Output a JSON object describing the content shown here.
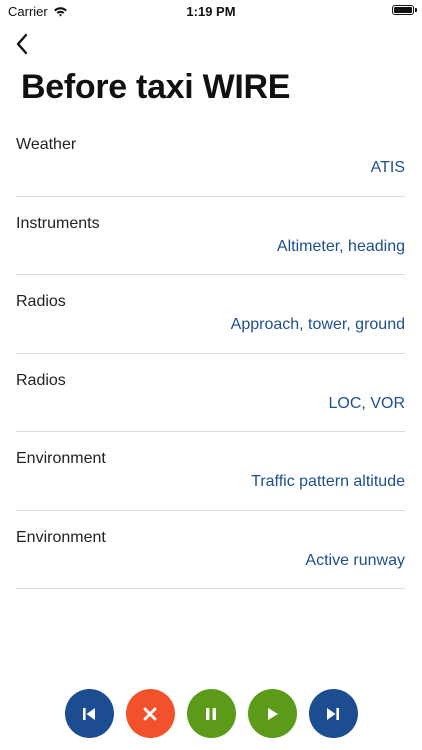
{
  "status_bar": {
    "carrier": "Carrier",
    "time": "1:19 PM"
  },
  "header": {
    "title": "Before taxi WIRE"
  },
  "items": [
    {
      "label": "Weather",
      "value": "ATIS"
    },
    {
      "label": "Instruments",
      "value": "Altimeter, heading"
    },
    {
      "label": "Radios",
      "value": "Approach, tower, ground"
    },
    {
      "label": "Radios",
      "value": "LOC, VOR"
    },
    {
      "label": "Environment",
      "value": "Traffic pattern altitude"
    },
    {
      "label": "Environment",
      "value": "Active runway"
    }
  ],
  "controls": {
    "icons": [
      "skip-back-icon",
      "close-icon",
      "pause-icon",
      "play-icon",
      "skip-forward-icon"
    ],
    "colors": {
      "blue": "#1c4d91",
      "red": "#f1522c",
      "green": "#5c9a19"
    }
  },
  "colors": {
    "accent_text": "#1f4f8c",
    "separator": "#dcdcdc"
  }
}
